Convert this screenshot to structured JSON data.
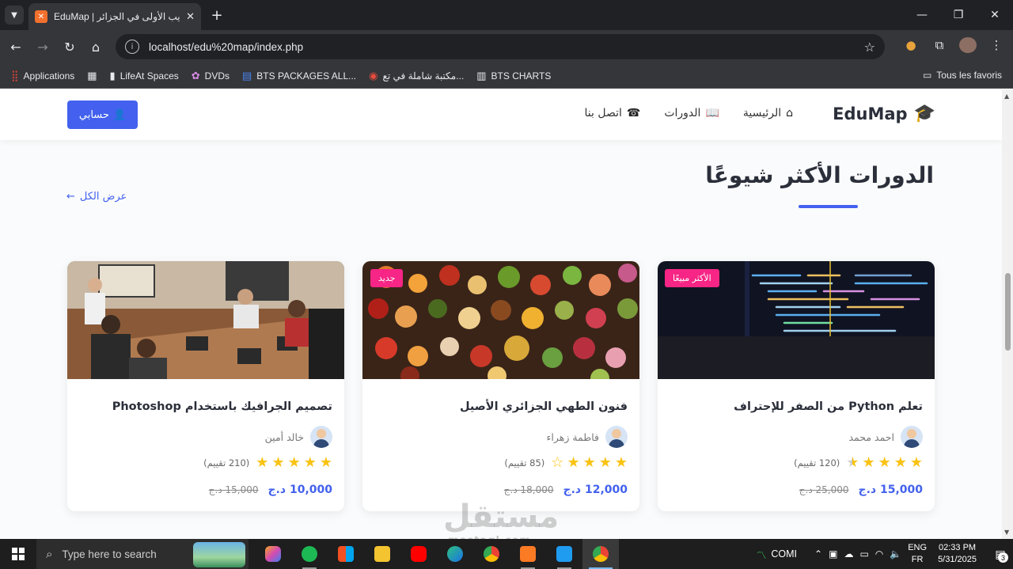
{
  "browser": {
    "tab_title": "EduMap | بوابة التدريب الأولى في الجزائر",
    "url": "localhost/edu%20map/index.php",
    "bookmarks": [
      {
        "label": "Applications",
        "icon": "apps-grid-icon"
      },
      {
        "label": "",
        "icon": "grid-icon"
      },
      {
        "label": "LifeAt Spaces",
        "icon": "lifeat-icon"
      },
      {
        "label": "DVDs",
        "icon": "flower-icon"
      },
      {
        "label": "BTS PACKAGES ALL...",
        "icon": "docs-icon"
      },
      {
        "label": "مكتبة شاملة في تع...",
        "icon": "library-icon"
      },
      {
        "label": "BTS CHARTS",
        "icon": "bts-icon"
      }
    ],
    "all_bookmarks": "Tous les favoris"
  },
  "site": {
    "logo": "EduMap",
    "nav": {
      "home": "الرئيسية",
      "courses": "الدورات",
      "contact": "اتصل بنا",
      "account": "حسابي"
    },
    "section_title": "الدورات الأكثر شيوعًا",
    "view_all": "عرض الكل"
  },
  "courses": [
    {
      "title": "تعلم Python من الصفر للإحتراف",
      "badge": "الأكثر مبيعًا",
      "instructor": "احمد محمد",
      "rating_stars": 4.5,
      "rating_count": "(120 تقييم)",
      "price": "15,000 د.ج",
      "old_price": "25,000 د.ج",
      "image": "code-screen"
    },
    {
      "title": "فنون الطهي الجزائري الأصيل",
      "badge": "جديد",
      "instructor": "فاطمة زهراء",
      "rating_stars": 4,
      "rating_count": "(85 تقييم)",
      "price": "12,000 د.ج",
      "old_price": "18,000 د.ج",
      "image": "food-spread"
    },
    {
      "title": "تصميم الجرافيك باستخدام Photoshop",
      "badge": "",
      "instructor": "خالد أمين",
      "rating_stars": 5,
      "rating_count": "(210 تقييم)",
      "price": "10,000 د.ج",
      "old_price": "15,000 د.ج",
      "image": "meeting-room"
    }
  ],
  "taskbar": {
    "search_placeholder": "Type here to search",
    "tray_label": "COMI",
    "lang_top": "ENG",
    "lang_bottom": "FR",
    "time": "02:33 PM",
    "date": "5/31/2025",
    "notifications": "3"
  },
  "watermark": {
    "text": "مستقل",
    "sub": "mostaql.com"
  }
}
